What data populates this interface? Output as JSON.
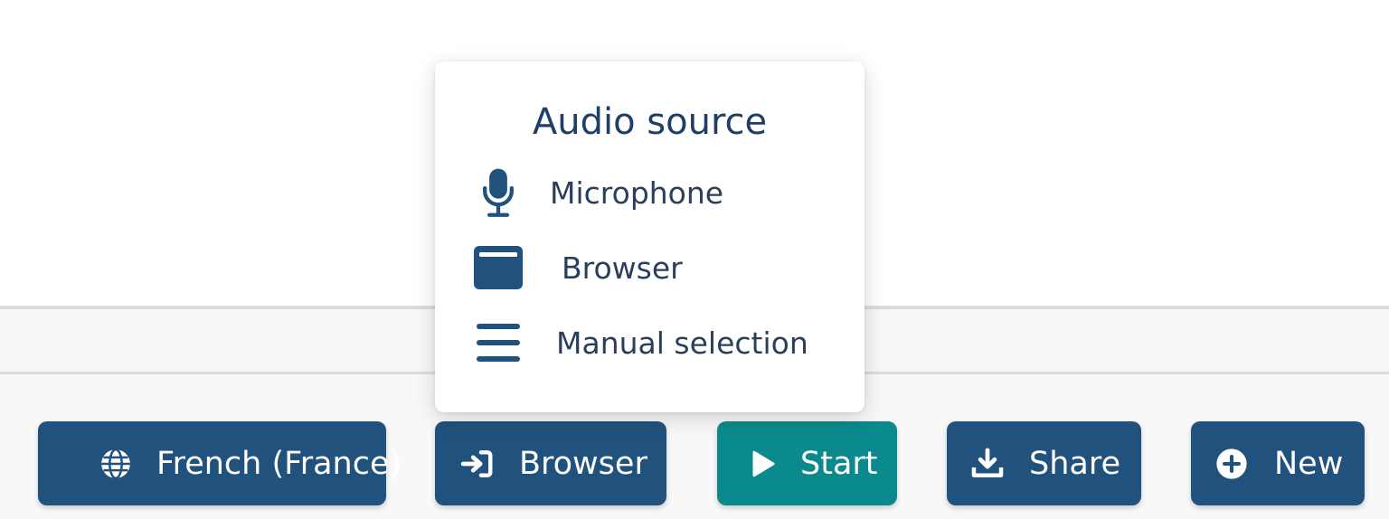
{
  "colors": {
    "primary": "#21527d",
    "accent_teal": "#0a8a8c",
    "text_dark": "#1f3f66",
    "background": "#ffffff",
    "toolbar_background": "#f8f8f9"
  },
  "popover": {
    "title": "Audio source",
    "items": [
      {
        "label": "Microphone",
        "icon": "microphone-icon"
      },
      {
        "label": "Browser",
        "icon": "browser-window-icon"
      },
      {
        "label": "Manual selection",
        "icon": "menu-lines-icon"
      }
    ]
  },
  "toolbar": {
    "language": {
      "label": "French (France)",
      "icon": "globe-icon"
    },
    "source": {
      "label": "Browser",
      "icon": "sign-in-icon"
    },
    "start": {
      "label": "Start",
      "icon": "play-icon"
    },
    "share": {
      "label": "Share",
      "icon": "download-icon"
    },
    "new": {
      "label": "New",
      "icon": "plus-circle-icon"
    }
  }
}
